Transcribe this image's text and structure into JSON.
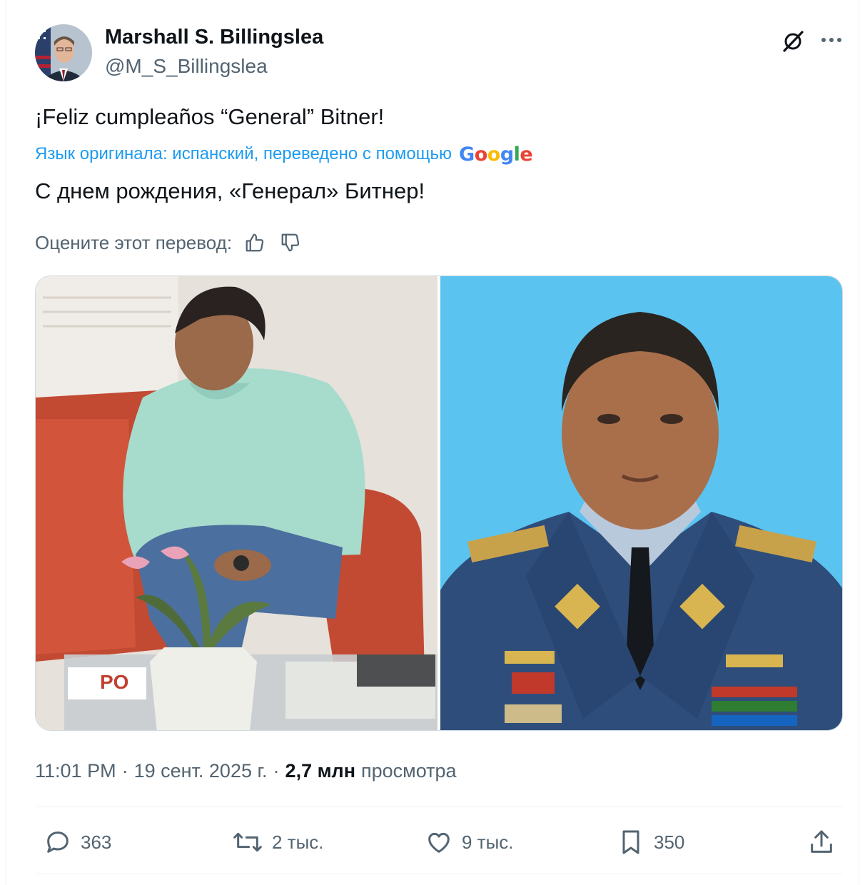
{
  "author": {
    "name": "Marshall S. Billingslea",
    "handle": "@M_S_Billingslea"
  },
  "tweet": {
    "text": "¡Feliz cumpleaños “General” Bitner!",
    "translation_note": "Язык оригинала: испанский, переведено с помощью",
    "translation_provider": "Google",
    "translated_text": "С днем рождения, «Генерал» Битнер!",
    "rate_label": "Оцените этот перевод:"
  },
  "meta": {
    "time": "11:01 PM",
    "date": "19 сент. 2025 г.",
    "views_count": "2,7 млн",
    "views_label": "просмотра",
    "separator": "·"
  },
  "actions": {
    "replies": "363",
    "reposts": "2 тыс.",
    "likes": "9 тыс.",
    "bookmarks": "350"
  },
  "colors": {
    "accent": "#1d9bf0",
    "secondary_text": "#536471",
    "primary_text": "#0f1419",
    "photo_right_background": "#5bc3f0"
  },
  "icons": [
    "grok-icon",
    "more-icon",
    "thumbs-up-icon",
    "thumbs-down-icon",
    "reply-icon",
    "repost-icon",
    "like-icon",
    "bookmark-icon",
    "share-icon"
  ]
}
